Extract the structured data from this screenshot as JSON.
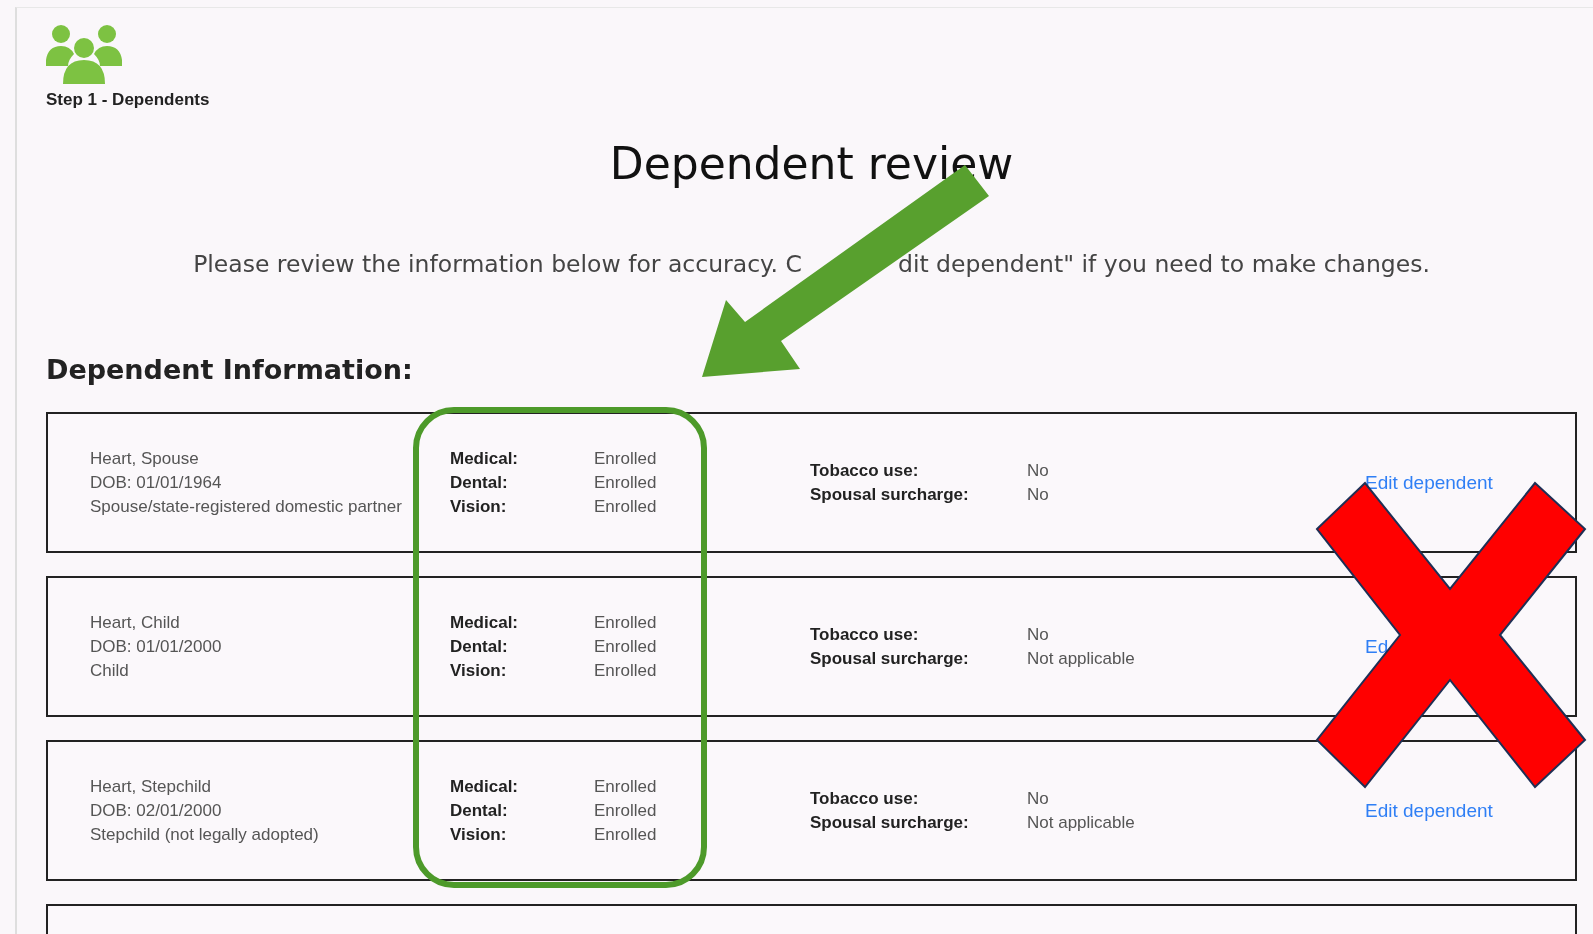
{
  "step": {
    "label": "Step 1 - Dependents"
  },
  "title": "Dependent review",
  "intro": [
    "Please review the information below for accuracy. C",
    "dit dependent\" if you need to make changes."
  ],
  "section_title": "Dependent Information:",
  "dependents": [
    {
      "name": "Heart, Spouse",
      "dob": "DOB: 01/01/1964",
      "relationship": "Spouse/state-registered domestic partner",
      "coverage": [
        {
          "label": "Medical:",
          "value": "Enrolled"
        },
        {
          "label": "Dental:",
          "value": "Enrolled"
        },
        {
          "label": "Vision:",
          "value": "Enrolled"
        }
      ],
      "details": [
        {
          "label": "Tobacco use:",
          "value": "No"
        },
        {
          "label": "Spousal surcharge:",
          "value": "No"
        }
      ],
      "action": "Edit dependent"
    },
    {
      "name": "Heart, Child",
      "dob": "DOB: 01/01/2000",
      "relationship": "Child",
      "coverage": [
        {
          "label": "Medical:",
          "value": "Enrolled"
        },
        {
          "label": "Dental:",
          "value": "Enrolled"
        },
        {
          "label": "Vision:",
          "value": "Enrolled"
        }
      ],
      "details": [
        {
          "label": "Tobacco use:",
          "value": "No"
        },
        {
          "label": "Spousal surcharge:",
          "value": "Not applicable"
        }
      ],
      "action": "Ed"
    },
    {
      "name": "Heart, Stepchild",
      "dob": "DOB: 02/01/2000",
      "relationship": "Stepchild (not legally adopted)",
      "coverage": [
        {
          "label": "Medical:",
          "value": "Enrolled"
        },
        {
          "label": "Dental:",
          "value": "Enrolled"
        },
        {
          "label": "Vision:",
          "value": "Enrolled"
        }
      ],
      "details": [
        {
          "label": "Tobacco use:",
          "value": "No"
        },
        {
          "label": "Spousal surcharge:",
          "value": "Not applicable"
        }
      ],
      "action": "Edit dependent"
    }
  ]
}
